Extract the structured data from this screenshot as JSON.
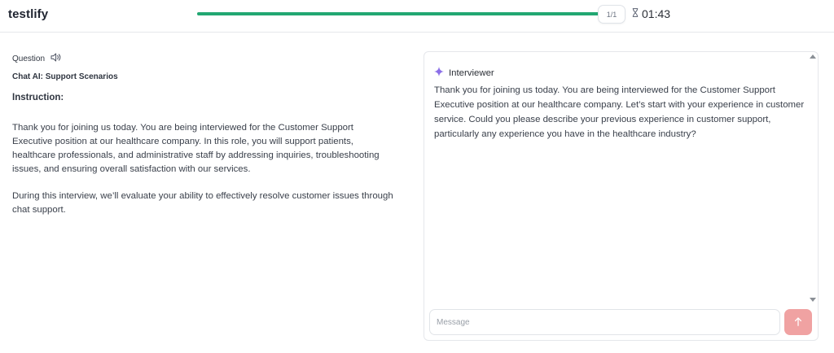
{
  "header": {
    "logo_text": "testlify",
    "progress_fraction": 1.0,
    "progress_color": "#22a772",
    "page_indicator": "1/1",
    "timer_icon": "hourglass-icon",
    "timer": "01:43"
  },
  "question": {
    "label": "Question",
    "speaker_icon": "speaker-icon",
    "title": "Chat AI: Support Scenarios",
    "instruction_label": "Instruction:",
    "paragraphs": [
      "Thank you for joining us today. You are being interviewed for the Customer Support Executive position at our healthcare company. In this role, you will support patients, healthcare professionals, and administrative staff by addressing inquiries, troubleshooting issues, and ensuring overall satisfaction with our services.",
      "During this interview, we’ll evaluate your ability to effectively resolve customer issues through chat support."
    ]
  },
  "chat": {
    "sender_icon": "sparkle-icon",
    "sender_color": "#8b6fe8",
    "sender": "Interviewer",
    "message": "Thank you for joining us today. You are being interviewed for the Customer Support Executive position at our healthcare company. Let’s start with your experience in customer service. Could you please describe your previous experience in customer support, particularly any experience you have in the healthcare industry?",
    "input_placeholder": "Message",
    "input_value": "",
    "send_icon": "arrow-up-icon",
    "send_color": "#f0a2a2"
  }
}
